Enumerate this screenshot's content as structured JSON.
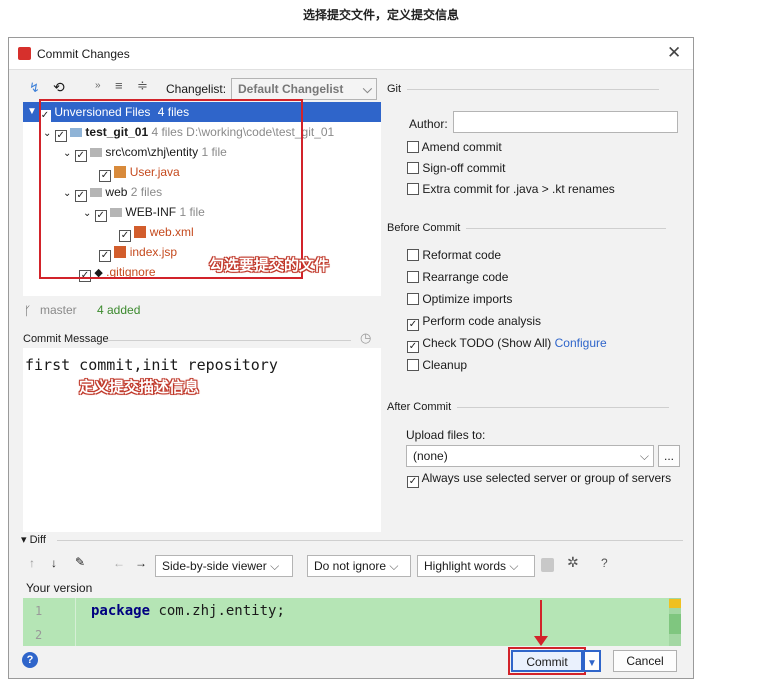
{
  "banner": "选择提交文件，定义提交信息",
  "dialog": {
    "title": "Commit Changes"
  },
  "toolbar": {
    "changelist_label": "Changelist:",
    "changelist_value": "Default Changelist"
  },
  "tree": [
    {
      "label": "Unversioned Files",
      "meta": "4 files"
    },
    {
      "label": "test_git_01",
      "meta": "4 files  D:\\working\\code\\test_git_01"
    },
    {
      "label": "src\\com\\zhj\\entity",
      "meta": "1 file"
    },
    {
      "label": "User.java",
      "meta": ""
    },
    {
      "label": "web",
      "meta": "2 files"
    },
    {
      "label": "WEB-INF",
      "meta": "1 file"
    },
    {
      "label": "web.xml",
      "meta": ""
    },
    {
      "label": "index.jsp",
      "meta": ""
    },
    {
      "label": ".gitignore",
      "meta": ""
    }
  ],
  "annotation_files": "勾选要提交的文件",
  "branch": {
    "name": "master",
    "added": "4 added"
  },
  "commit_message": {
    "label": "Commit Message",
    "text": "first commit,init repository"
  },
  "annotation_message": "定义提交描述信息",
  "git": {
    "section": "Git",
    "author_label": "Author:",
    "author_value": "",
    "options": [
      {
        "label": "Amend commit",
        "checked": false
      },
      {
        "label": "Sign-off commit",
        "checked": false
      },
      {
        "label": "Extra commit for .java > .kt renames",
        "checked": false
      }
    ]
  },
  "before_commit": {
    "section": "Before Commit",
    "options": [
      {
        "label": "Reformat code",
        "checked": false
      },
      {
        "label": "Rearrange code",
        "checked": false
      },
      {
        "label": "Optimize imports",
        "checked": false
      },
      {
        "label": "Perform code analysis",
        "checked": true
      },
      {
        "label": "Check TODO (Show All)",
        "checked": true
      },
      {
        "label": "Cleanup",
        "checked": false
      }
    ],
    "configure": "Configure"
  },
  "after_commit": {
    "section": "After Commit",
    "upload_label": "Upload files to:",
    "upload_value": "(none)",
    "always_label": "Always use selected server or group of servers"
  },
  "diff": {
    "label": "Diff",
    "viewer": "Side-by-side viewer",
    "ignore": "Do not ignore",
    "highlight": "Highlight words",
    "help": "?",
    "your_version": "Your version",
    "lines": [
      {
        "num": "1",
        "kw": "package",
        "rest": " com.zhj.entity;"
      },
      {
        "num": "2",
        "kw": "",
        "rest": ""
      }
    ]
  },
  "buttons": {
    "commit": "Commit",
    "cancel": "Cancel",
    "help": "?"
  },
  "colors": {
    "accent": "#2f65ca",
    "selection": "#2f65ca",
    "diff_bg": "#b5e5b5",
    "annotation": "#d2232a",
    "keyword": "#000080"
  }
}
